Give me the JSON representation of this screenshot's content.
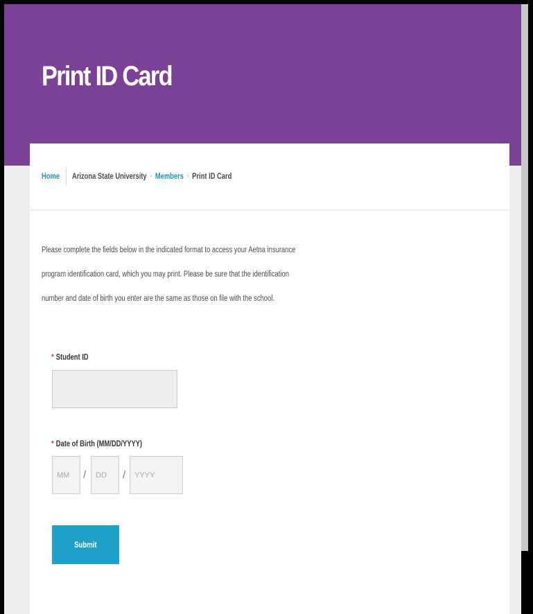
{
  "page": {
    "title": "Print ID Card"
  },
  "breadcrumb": {
    "items": [
      {
        "label": "Home",
        "link": true
      },
      {
        "label": "Arizona State University",
        "link": false
      },
      {
        "label": "Members",
        "link": true
      },
      {
        "label": "Print ID Card",
        "link": false
      }
    ],
    "separator": "›"
  },
  "intro": {
    "text": "Please complete the fields below in the indicated format to access your Aetna insurance program identification card, which you may print. Please be sure that the identification number and date of birth you enter are the same as those on file with the school."
  },
  "form": {
    "required_marker": "*",
    "student_id": {
      "label": "Student ID",
      "value": "",
      "placeholder": ""
    },
    "dob": {
      "label": "Date of Birth (MM/DD/YYYY)",
      "month_placeholder": "MM",
      "day_placeholder": "DD",
      "year_placeholder": "YYYY",
      "separator": "/"
    },
    "submit_label": "Submit"
  },
  "colors": {
    "header_band": "#7b4196",
    "link": "#1f93b8",
    "submit": "#1da1c8",
    "required": "#d9362b"
  }
}
